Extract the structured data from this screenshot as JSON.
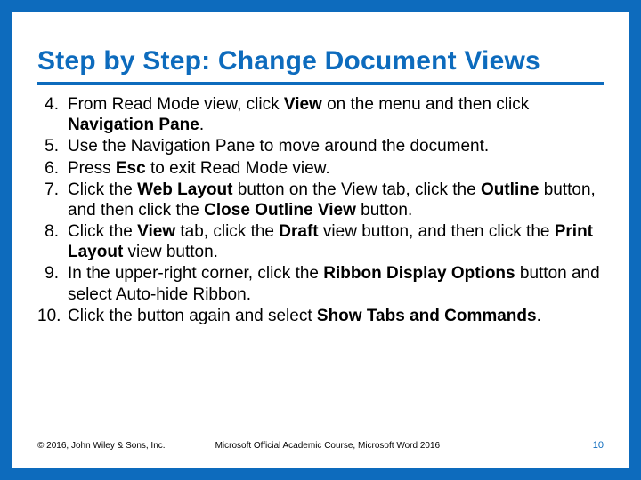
{
  "title": "Step by Step: Change Document Views",
  "start_number": 4,
  "steps": [
    {
      "num": "4.",
      "segments": [
        {
          "t": "From Read Mode view, click "
        },
        {
          "t": "View",
          "b": true
        },
        {
          "t": " on the menu and then click "
        },
        {
          "t": "Navigation Pane",
          "b": true
        },
        {
          "t": "."
        }
      ]
    },
    {
      "num": "5.",
      "segments": [
        {
          "t": "Use the Navigation Pane to move around the document."
        }
      ]
    },
    {
      "num": "6.",
      "segments": [
        {
          "t": "Press "
        },
        {
          "t": "Esc",
          "b": true
        },
        {
          "t": " to exit Read Mode view."
        }
      ]
    },
    {
      "num": "7.",
      "segments": [
        {
          "t": "Click the "
        },
        {
          "t": "Web Layout",
          "b": true
        },
        {
          "t": " button on the View tab, click the "
        },
        {
          "t": "Outline",
          "b": true
        },
        {
          "t": " button, and then click the "
        },
        {
          "t": "Close Outline View",
          "b": true
        },
        {
          "t": " button."
        }
      ]
    },
    {
      "num": "8.",
      "segments": [
        {
          "t": "Click the "
        },
        {
          "t": "View",
          "b": true
        },
        {
          "t": " tab, click the "
        },
        {
          "t": "Draft",
          "b": true
        },
        {
          "t": " view button, and then click the "
        },
        {
          "t": "Print Layout",
          "b": true
        },
        {
          "t": " view button."
        }
      ]
    },
    {
      "num": "9.",
      "segments": [
        {
          "t": "In the upper-right corner, click the "
        },
        {
          "t": "Ribbon Display Options",
          "b": true
        },
        {
          "t": " button and select Auto-hide Ribbon."
        }
      ]
    },
    {
      "num": "10.",
      "segments": [
        {
          "t": "Click the button again and select "
        },
        {
          "t": "Show Tabs and Commands",
          "b": true
        },
        {
          "t": "."
        }
      ]
    }
  ],
  "footer": {
    "copyright": "© 2016, John Wiley & Sons, Inc.",
    "course": "Microsoft Official Academic Course, Microsoft Word 2016",
    "page": "10"
  }
}
